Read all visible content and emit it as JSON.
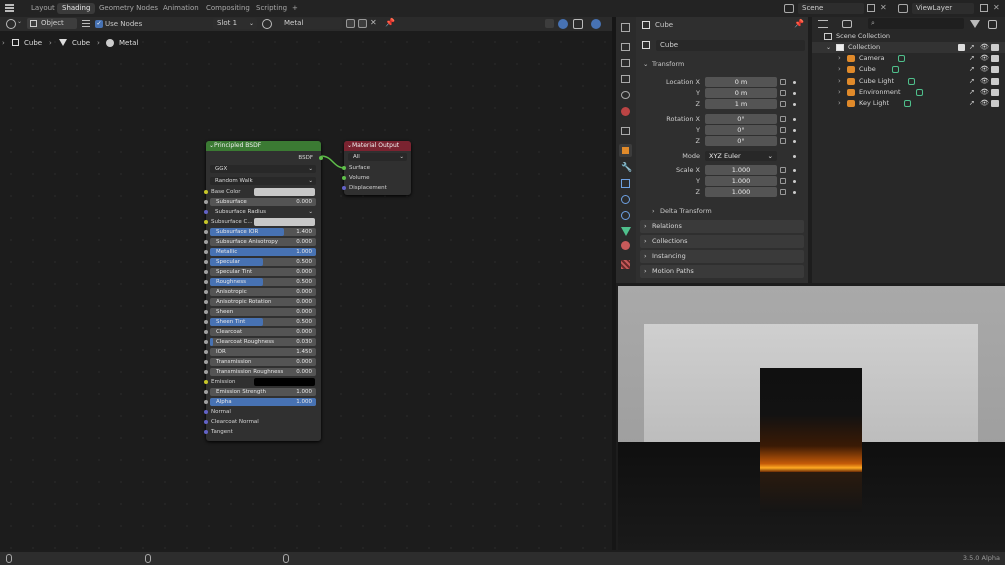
{
  "topbar": {
    "tabs": [
      "Layout",
      "Shading",
      "Geometry Nodes",
      "Animation",
      "Compositing",
      "Scripting"
    ],
    "active_tab": "Shading",
    "add_tab": "+",
    "scene": "Scene",
    "view_layer": "ViewLayer"
  },
  "node_header": {
    "mode": "Object",
    "use_nodes": "Use Nodes",
    "slot": "Slot 1",
    "material": "Metal"
  },
  "breadcrumb": [
    "Cube",
    "Cube",
    "Metal"
  ],
  "bsdf_node": {
    "title": "Principled BSDF",
    "output": "BSDF",
    "distribution": "GGX",
    "subsurface_method": "Random Walk",
    "base_color_label": "Base Color",
    "subsurface_radius": "Subsurface Radius",
    "subsurface_color": "Subsurface C...",
    "sliders": [
      {
        "label": "Subsurface",
        "value": "0.000",
        "fill": 0
      },
      {
        "label": "Subsurface IOR",
        "value": "1.400",
        "fill": 0.7
      },
      {
        "label": "Subsurface Anisotropy",
        "value": "0.000",
        "fill": 0
      },
      {
        "label": "Metallic",
        "value": "1.000",
        "fill": 1
      },
      {
        "label": "Specular",
        "value": "0.500",
        "fill": 0.5
      },
      {
        "label": "Specular Tint",
        "value": "0.000",
        "fill": 0
      },
      {
        "label": "Roughness",
        "value": "0.500",
        "fill": 0.5
      },
      {
        "label": "Anisotropic",
        "value": "0.000",
        "fill": 0
      },
      {
        "label": "Anisotropic Rotation",
        "value": "0.000",
        "fill": 0
      },
      {
        "label": "Sheen",
        "value": "0.000",
        "fill": 0
      },
      {
        "label": "Sheen Tint",
        "value": "0.500",
        "fill": 0.5
      },
      {
        "label": "Clearcoat",
        "value": "0.000",
        "fill": 0
      },
      {
        "label": "Clearcoat Roughness",
        "value": "0.030",
        "fill": 0.03
      },
      {
        "label": "IOR",
        "value": "1.450",
        "fill": 0
      },
      {
        "label": "Transmission",
        "value": "0.000",
        "fill": 0
      },
      {
        "label": "Transmission Roughness",
        "value": "0.000",
        "fill": 0
      }
    ],
    "emission": "Emission",
    "emission_strength": {
      "label": "Emission Strength",
      "value": "1.000",
      "fill": 0
    },
    "alpha": {
      "label": "Alpha",
      "value": "1.000",
      "fill": 1
    },
    "normal": "Normal",
    "clearcoat_normal": "Clearcoat Normal",
    "tangent": "Tangent"
  },
  "output_node": {
    "title": "Material Output",
    "target": "All",
    "inputs": [
      "Surface",
      "Volume",
      "Displacement"
    ]
  },
  "properties": {
    "object_name": "Cube",
    "object_field": "Cube",
    "transform": "Transform",
    "location_label": "Location X",
    "rotation_label": "Rotation X",
    "scale_label": "Scale X",
    "y": "Y",
    "z": "Z",
    "location": [
      "0 m",
      "0 m",
      "1 m"
    ],
    "rotation": [
      "0°",
      "0°",
      "0°"
    ],
    "mode_label": "Mode",
    "mode": "XYZ Euler",
    "scale": [
      "1.000",
      "1.000",
      "1.000"
    ],
    "delta": "Delta Transform",
    "panels": [
      "Relations",
      "Collections",
      "Instancing",
      "Motion Paths"
    ]
  },
  "outliner": {
    "scene_collection": "Scene Collection",
    "collection": "Collection",
    "items": [
      "Camera",
      "Cube",
      "Cube Light",
      "Environment",
      "Key Light"
    ]
  },
  "version": "3.5.0 Alpha",
  "colors": {
    "accent": "#4772b3",
    "bsdf_header": "#3b7a33",
    "output_header": "#7a2330",
    "socket_yellow": "#c7c729",
    "socket_purple": "#6363c7",
    "socket_gray": "#a1a1a1",
    "link_green": "#5fbf4a"
  }
}
